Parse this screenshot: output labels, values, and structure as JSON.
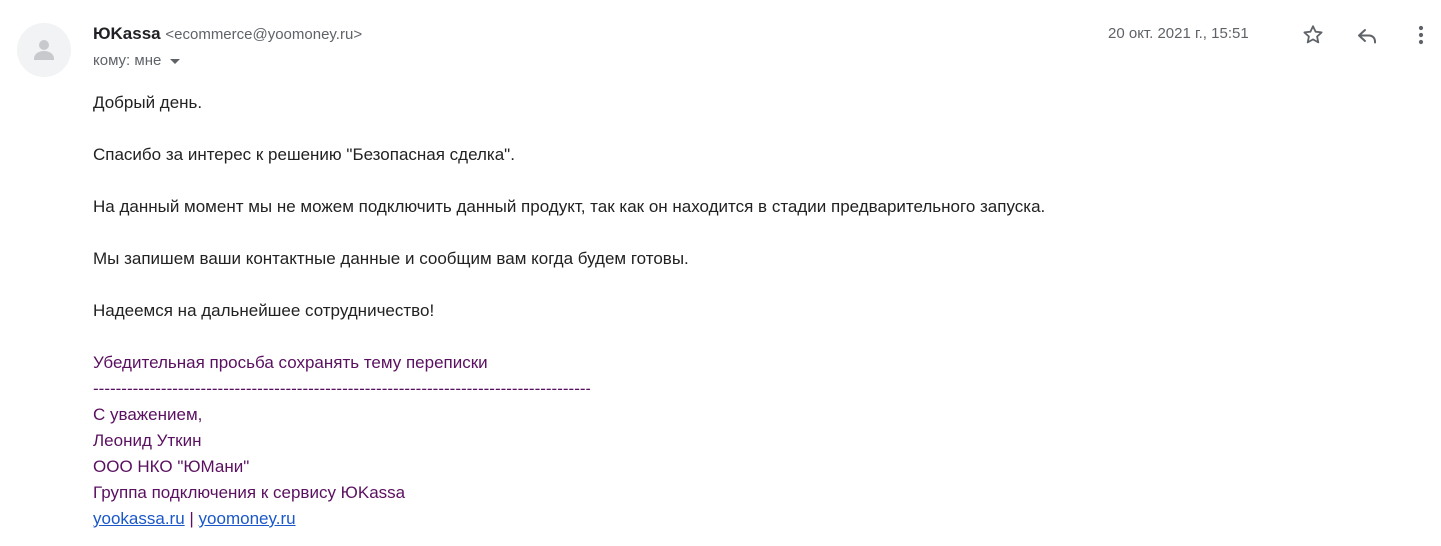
{
  "sender": {
    "name": "ЮKassa",
    "email": "<ecommerce@yoomoney.ru>"
  },
  "recipient": {
    "label": "кому: мне"
  },
  "date": "20 окт. 2021 г., 15:51",
  "actions": {
    "star_icon": "star-icon",
    "reply_icon": "reply-icon",
    "more_icon": "more-vert-icon"
  },
  "body": {
    "greeting": "Добрый день.",
    "p1": "Спасибо за интерес к решению \"Безопасная сделка\".",
    "p2": "На данный момент мы не можем подключить данный продукт, так как он находится в стадии предварительного запуска.",
    "p3": "Мы запишем ваши контактные данные и сообщим вам когда будем готовы.",
    "p4": "Надеемся на дальнейшее сотрудничество!"
  },
  "signature": {
    "request": "Убедительная просьба сохранять тему переписки",
    "separator": "-----------------------------------------------------------------------------------------",
    "regards": "С уважением,",
    "person": "Леонид Уткин",
    "company": "ООО НКО \"ЮМани\"",
    "department": "Группа подключения к сервису ЮKassa",
    "link1": "yookassa.ru",
    "link_sep": " | ",
    "link2": "yoomoney.ru"
  },
  "colors": {
    "signature": "#5a1060",
    "link": "#1a57c9",
    "meta": "#5f6368"
  }
}
